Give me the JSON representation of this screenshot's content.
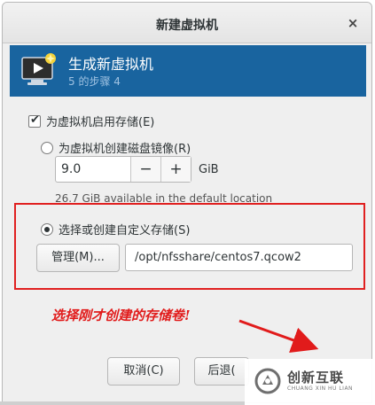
{
  "dialog": {
    "title": "新建虚拟机",
    "close_glyph": "×"
  },
  "banner": {
    "heading": "生成新虚拟机",
    "step": "5 的步骤 4"
  },
  "storage": {
    "enable_label": "为虚拟机启用存储(E)",
    "enable_checked": true,
    "create_disk_label": "为虚拟机创建磁盘镜像(R)",
    "disk_size_value": "9.0",
    "minus_glyph": "−",
    "plus_glyph": "+",
    "unit": "GiB",
    "available_text": "26.7 GiB available in the default location",
    "custom_label": "选择或创建自定义存储(S)",
    "custom_selected": true,
    "manage_button": "管理(M)...",
    "path_value": "/opt/nfsshare/centos7.qcow2"
  },
  "buttons": {
    "cancel": "取消(C)",
    "back": "后退("
  },
  "annotation": {
    "text": "选择刚才创建的存储卷!",
    "color": "#e11b1b"
  },
  "watermark": {
    "cn": "创新互联",
    "en": "CHUANG XIN HU LIAN"
  },
  "colors": {
    "banner": "#19649f",
    "highlight": "#e02020"
  }
}
